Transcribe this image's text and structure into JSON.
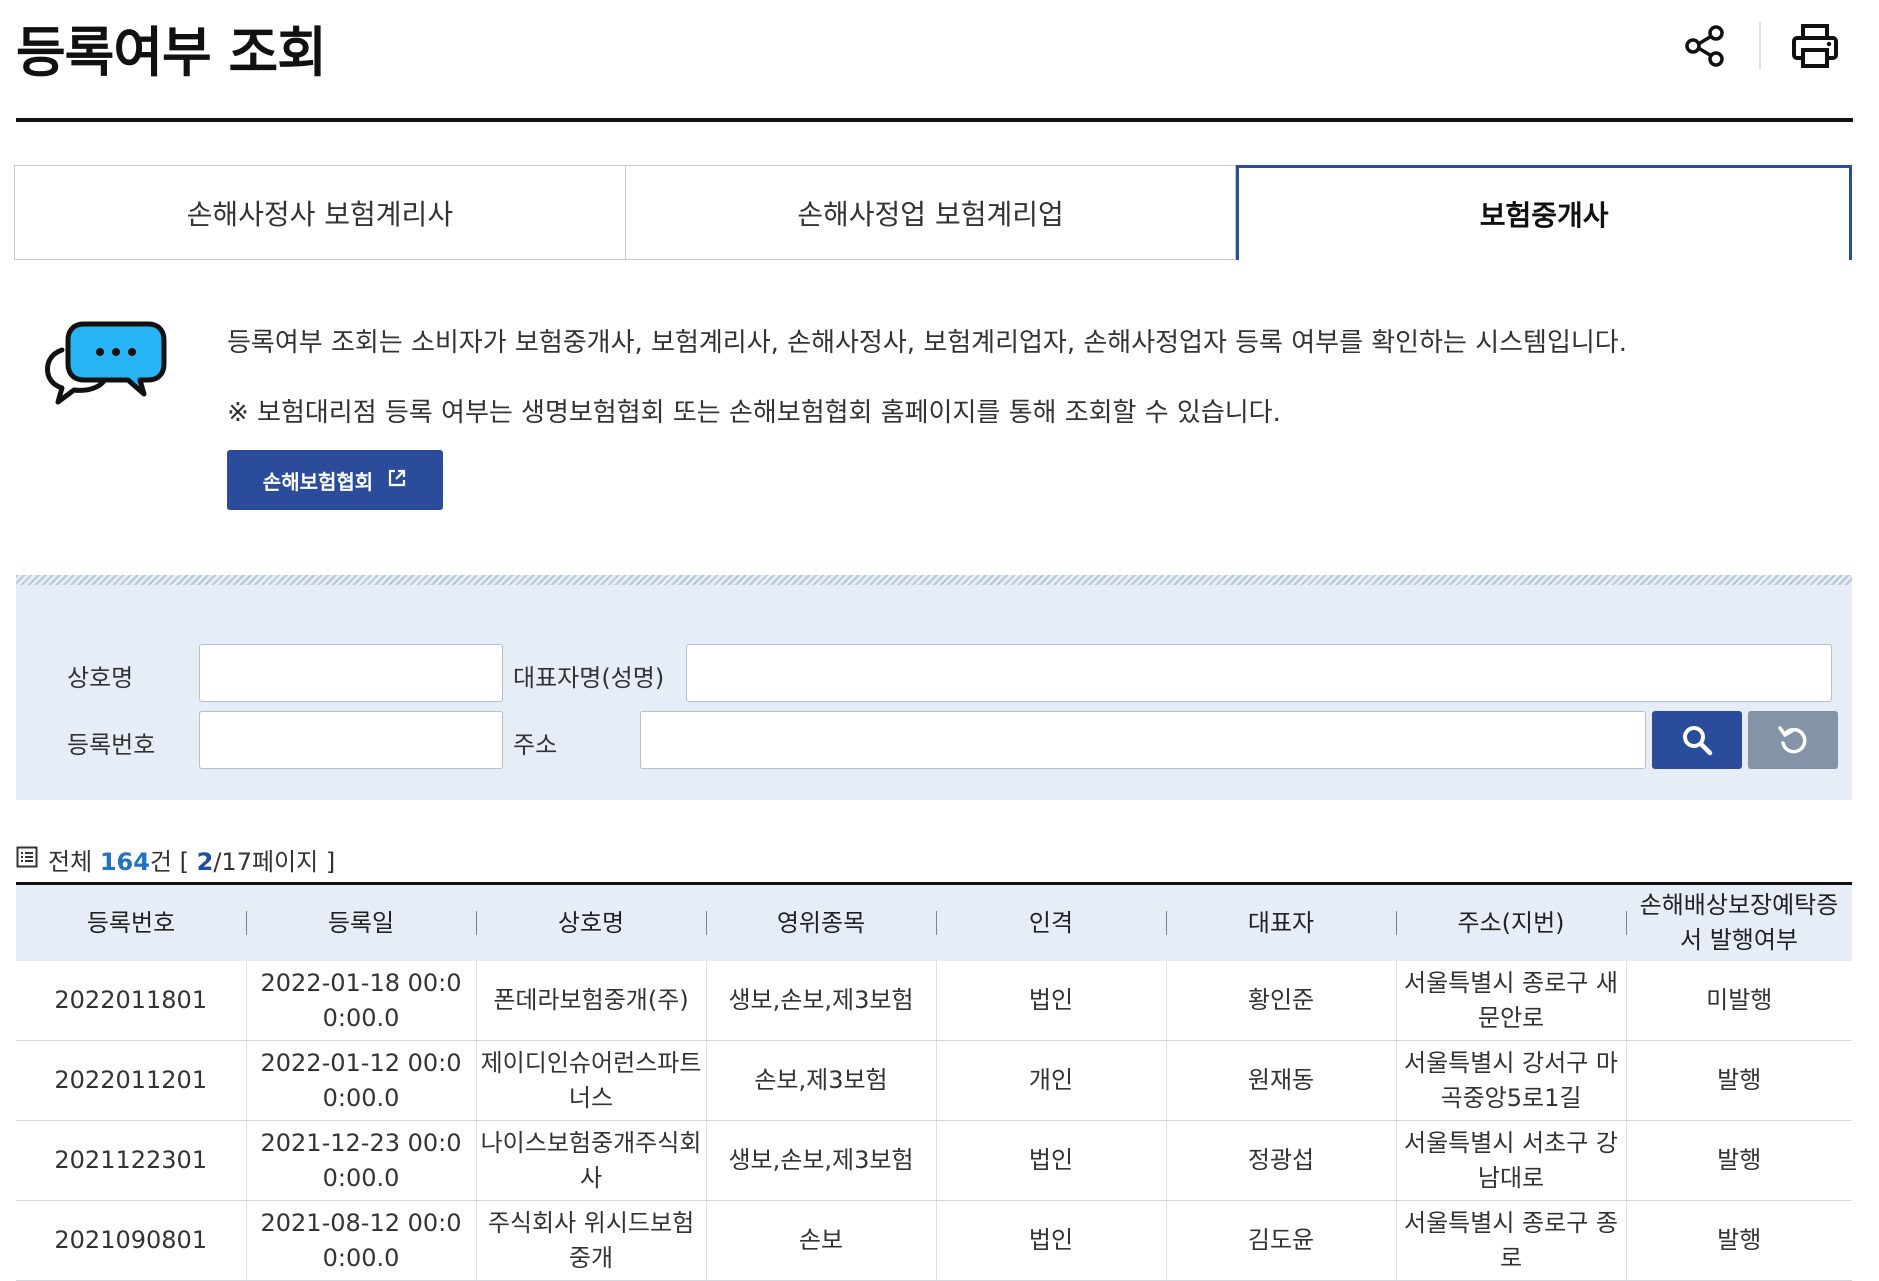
{
  "page_title": "등록여부 조회",
  "header_icons": [
    "share-icon",
    "print-icon"
  ],
  "tabs": [
    {
      "label": "손해사정사 보험계리사",
      "active": false
    },
    {
      "label": "손해사정업 보험계리업",
      "active": false
    },
    {
      "label": "보험중개사",
      "active": true
    }
  ],
  "info": {
    "line1": "등록여부 조회는 소비자가 보험중개사, 보험계리사, 손해사정사, 보험계리업자, 손해사정업자 등록 여부를 확인하는 시스템입니다.",
    "line2": "※ 보험대리점 등록 여부는 생명보험협회 또는 손해보험협회 홈페이지를 통해 조회할 수 있습니다.",
    "link_button": "손해보험협회"
  },
  "search": {
    "company_label": "상호명",
    "company_value": "",
    "rep_label": "대표자명(성명)",
    "rep_value": "",
    "regno_label": "등록번호",
    "regno_value": "",
    "address_label": "주소",
    "address_value": ""
  },
  "summary": {
    "total_prefix": "전체",
    "total_count": "164",
    "total_suffix": "건 [",
    "current_page": "2",
    "page_suffix": "/17페이지 ]"
  },
  "colors": {
    "primary": "#2b4c9b",
    "panel": "#e7edf6",
    "count": "#1f72c4"
  },
  "table": {
    "headers": [
      "등록번호",
      "등록일",
      "상호명",
      "영위종목",
      "인격",
      "대표자",
      "주소(지번)",
      "손해배상보장예탁증서 발행여부"
    ],
    "rows": [
      [
        "2022011801",
        "2022-01-18 00:00:00.0",
        "폰데라보험중개(주)",
        "생보,손보,제3보험",
        "법인",
        "황인준",
        "서울특별시 종로구 새문안로",
        "미발행"
      ],
      [
        "2022011201",
        "2022-01-12 00:00:00.0",
        "제이디인슈어런스파트너스",
        "손보,제3보험",
        "개인",
        "원재동",
        "서울특별시 강서구 마곡중앙5로1길",
        "발행"
      ],
      [
        "2021122301",
        "2021-12-23 00:00:00.0",
        "나이스보험중개주식회사",
        "생보,손보,제3보험",
        "법인",
        "정광섭",
        "서울특별시 서초구 강남대로",
        "발행"
      ],
      [
        "2021090801",
        "2021-08-12 00:00:00.0",
        "주식회사 위시드보험중개",
        "손보",
        "법인",
        "김도윤",
        "서울특별시 종로구 종로",
        "발행"
      ]
    ]
  }
}
